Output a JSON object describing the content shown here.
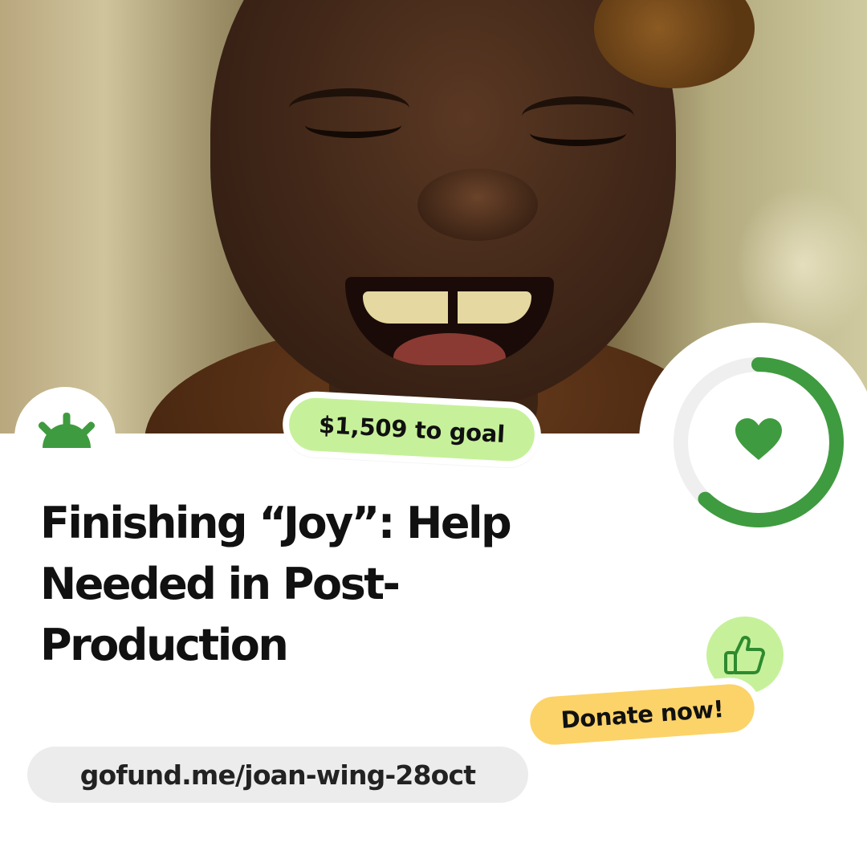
{
  "hero": {
    "image_icon": "smiling-person-photo"
  },
  "brand": {
    "logo_icon": "sunrise-logo-icon",
    "color": "#3f9b3f"
  },
  "campaign": {
    "title": "Finishing “Joy”:  Help Needed in Post-Production",
    "to_goal_label": "$1,509 to goal",
    "donate_label": "Donate now!",
    "url": "gofund.me/joan-wing-28oct"
  },
  "progress": {
    "fraction": 0.62,
    "ring_color": "#3f9b3f",
    "track_color": "#efefef",
    "icon": "heart-icon"
  },
  "stickers": {
    "goal_color": "#c6f19a",
    "donate_color": "#fcd368",
    "thumb_icon": "thumbs-up-icon"
  }
}
